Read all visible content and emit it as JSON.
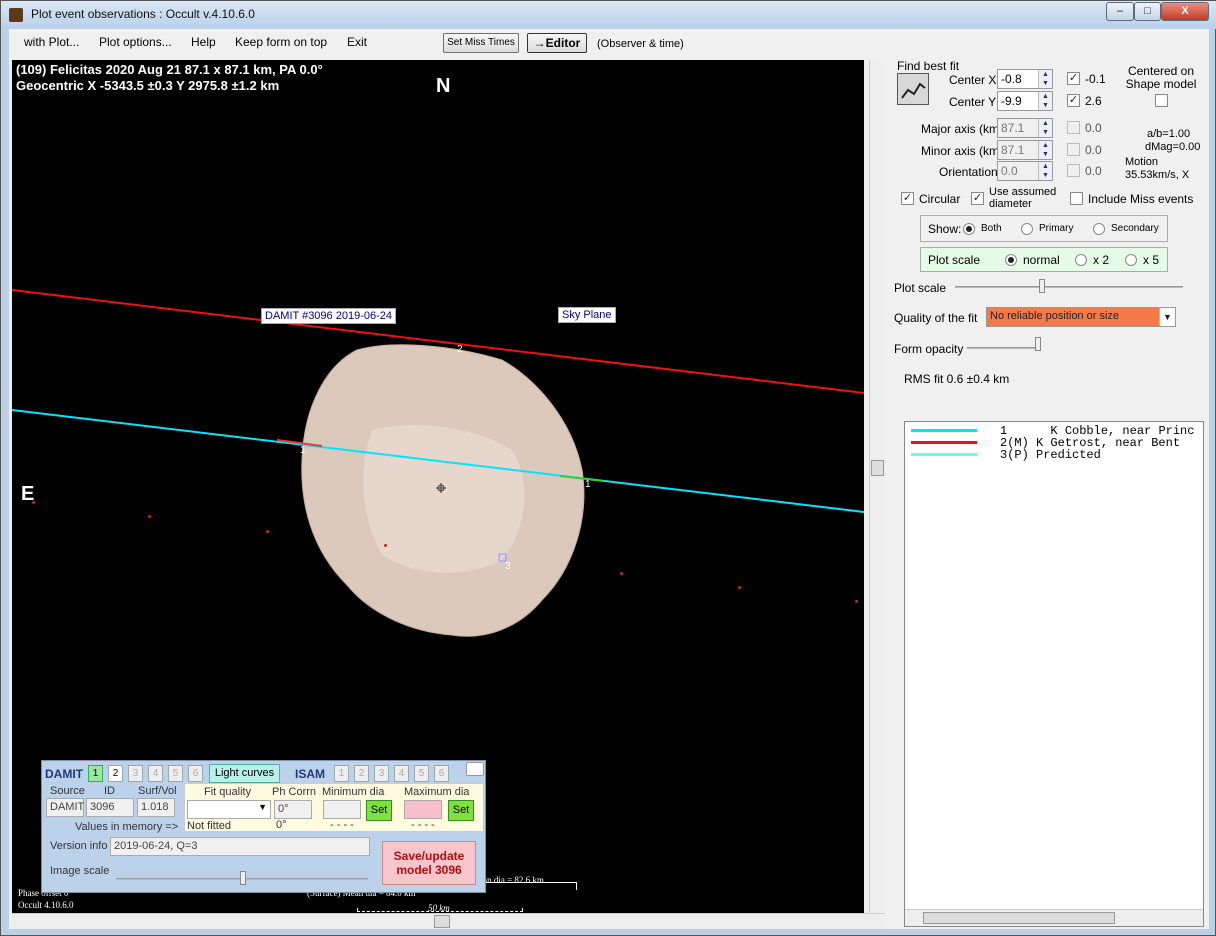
{
  "window": {
    "title": "Plot event observations : Occult v.4.10.6.0",
    "minimize": "–",
    "maximize": "□",
    "close": "X"
  },
  "menu": {
    "with_plot": "with Plot...",
    "plot_options": "Plot options...",
    "help": "Help",
    "keep_on_top": "Keep form on top",
    "exit": "Exit",
    "set_miss_times": "Set Miss Times",
    "editor": "→Editor",
    "observer_time": "(Observer & time)"
  },
  "plot": {
    "header_line1": "(109) Felicitas  2020 Aug 21  87.1 x 87.1 km, PA 0.0°",
    "header_line2": "Geocentric  X  -5343.5 ±0.3  Y 2975.8 ±1.2 km",
    "north": "N",
    "east": "E",
    "damit_label": "DAMIT #3096 2019-06-24",
    "sky_plane": "Sky Plane",
    "chord_labels": [
      "1",
      "1",
      "2",
      "3"
    ],
    "volume_dia": "(Volume) Mean dia = 82.6 km",
    "surface_dia": "(Surface) Mean dia = 84.0 km",
    "scale_bar": "50 km",
    "phase_offset": "Phase offset 0°",
    "version": "Occult 4.10.6.0"
  },
  "damit": {
    "title": "DAMIT",
    "isam": "ISAM",
    "model_numbers": [
      "1",
      "2",
      "3",
      "4",
      "5",
      "6"
    ],
    "light_curves": "Light curves",
    "source_label": "Source",
    "id_label": "ID",
    "surfvol_label": "Surf/Vol",
    "source": "DAMIT",
    "id": "3096",
    "surfvol": "1.018",
    "values_in_memory": "Values in memory =>",
    "fit_quality_label": "Fit quality",
    "ph_corrn_label": "Ph Corrn",
    "min_dia_label": "Minimum dia",
    "max_dia_label": "Maximum dia",
    "ph_corrn_value": "0°",
    "ph_corrn_memory": "0°",
    "not_fitted": "Not fitted",
    "min_dash": "- - - -",
    "max_dash": "- - - -",
    "set": "Set",
    "version_info_label": "Version info",
    "version_info": "2019-06-24, Q=3",
    "image_scale_label": "Image scale",
    "save_button": "Save/update model 3096"
  },
  "fit": {
    "find_best_fit": "Find best fit",
    "center_x_label": "Center X",
    "center_x": "-0.8",
    "center_x_out": "-0.1",
    "center_y_label": "Center Y",
    "center_y": "-9.9",
    "center_y_out": "2.6",
    "centered_on": "Centered on Shape model",
    "major_label": "Major axis (km)",
    "major": "87.1",
    "major_out": "0.0",
    "minor_label": "Minor axis (km)",
    "minor": "87.1",
    "minor_out": "0.0",
    "orient_label": "Orientation",
    "orient": "0.0",
    "orient_out": "0.0",
    "ab": "a/b=1.00",
    "dmag": "dMag=0.00",
    "motion_label": "Motion",
    "motion": "35.53km/s, X",
    "circular": "Circular",
    "use_assumed": "Use assumed diameter",
    "include_miss": "Include Miss events",
    "show_label": "Show:",
    "show_options": [
      "Both",
      "Primary",
      "Secondary"
    ],
    "plot_scale_box_label": "Plot scale",
    "scale_options": [
      "normal",
      "x 2",
      "x 5"
    ],
    "plot_scale_label": "Plot scale",
    "quality_label": "Quality of the fit",
    "quality_value": "No reliable position or size",
    "form_opacity": "Form opacity",
    "rms_fit": "RMS fit 0.6 ±0.4 km"
  },
  "legend": [
    {
      "num": "1",
      "flag": "   ",
      "text": "K Cobble, near Princ",
      "color": "#00e5ff"
    },
    {
      "num": "2",
      "flag": "(M)",
      "text": "K Getrost, near Bent",
      "color": "#ee1111"
    },
    {
      "num": "3",
      "flag": "(P)",
      "text": "Predicted",
      "color": "#66ffdd"
    }
  ]
}
